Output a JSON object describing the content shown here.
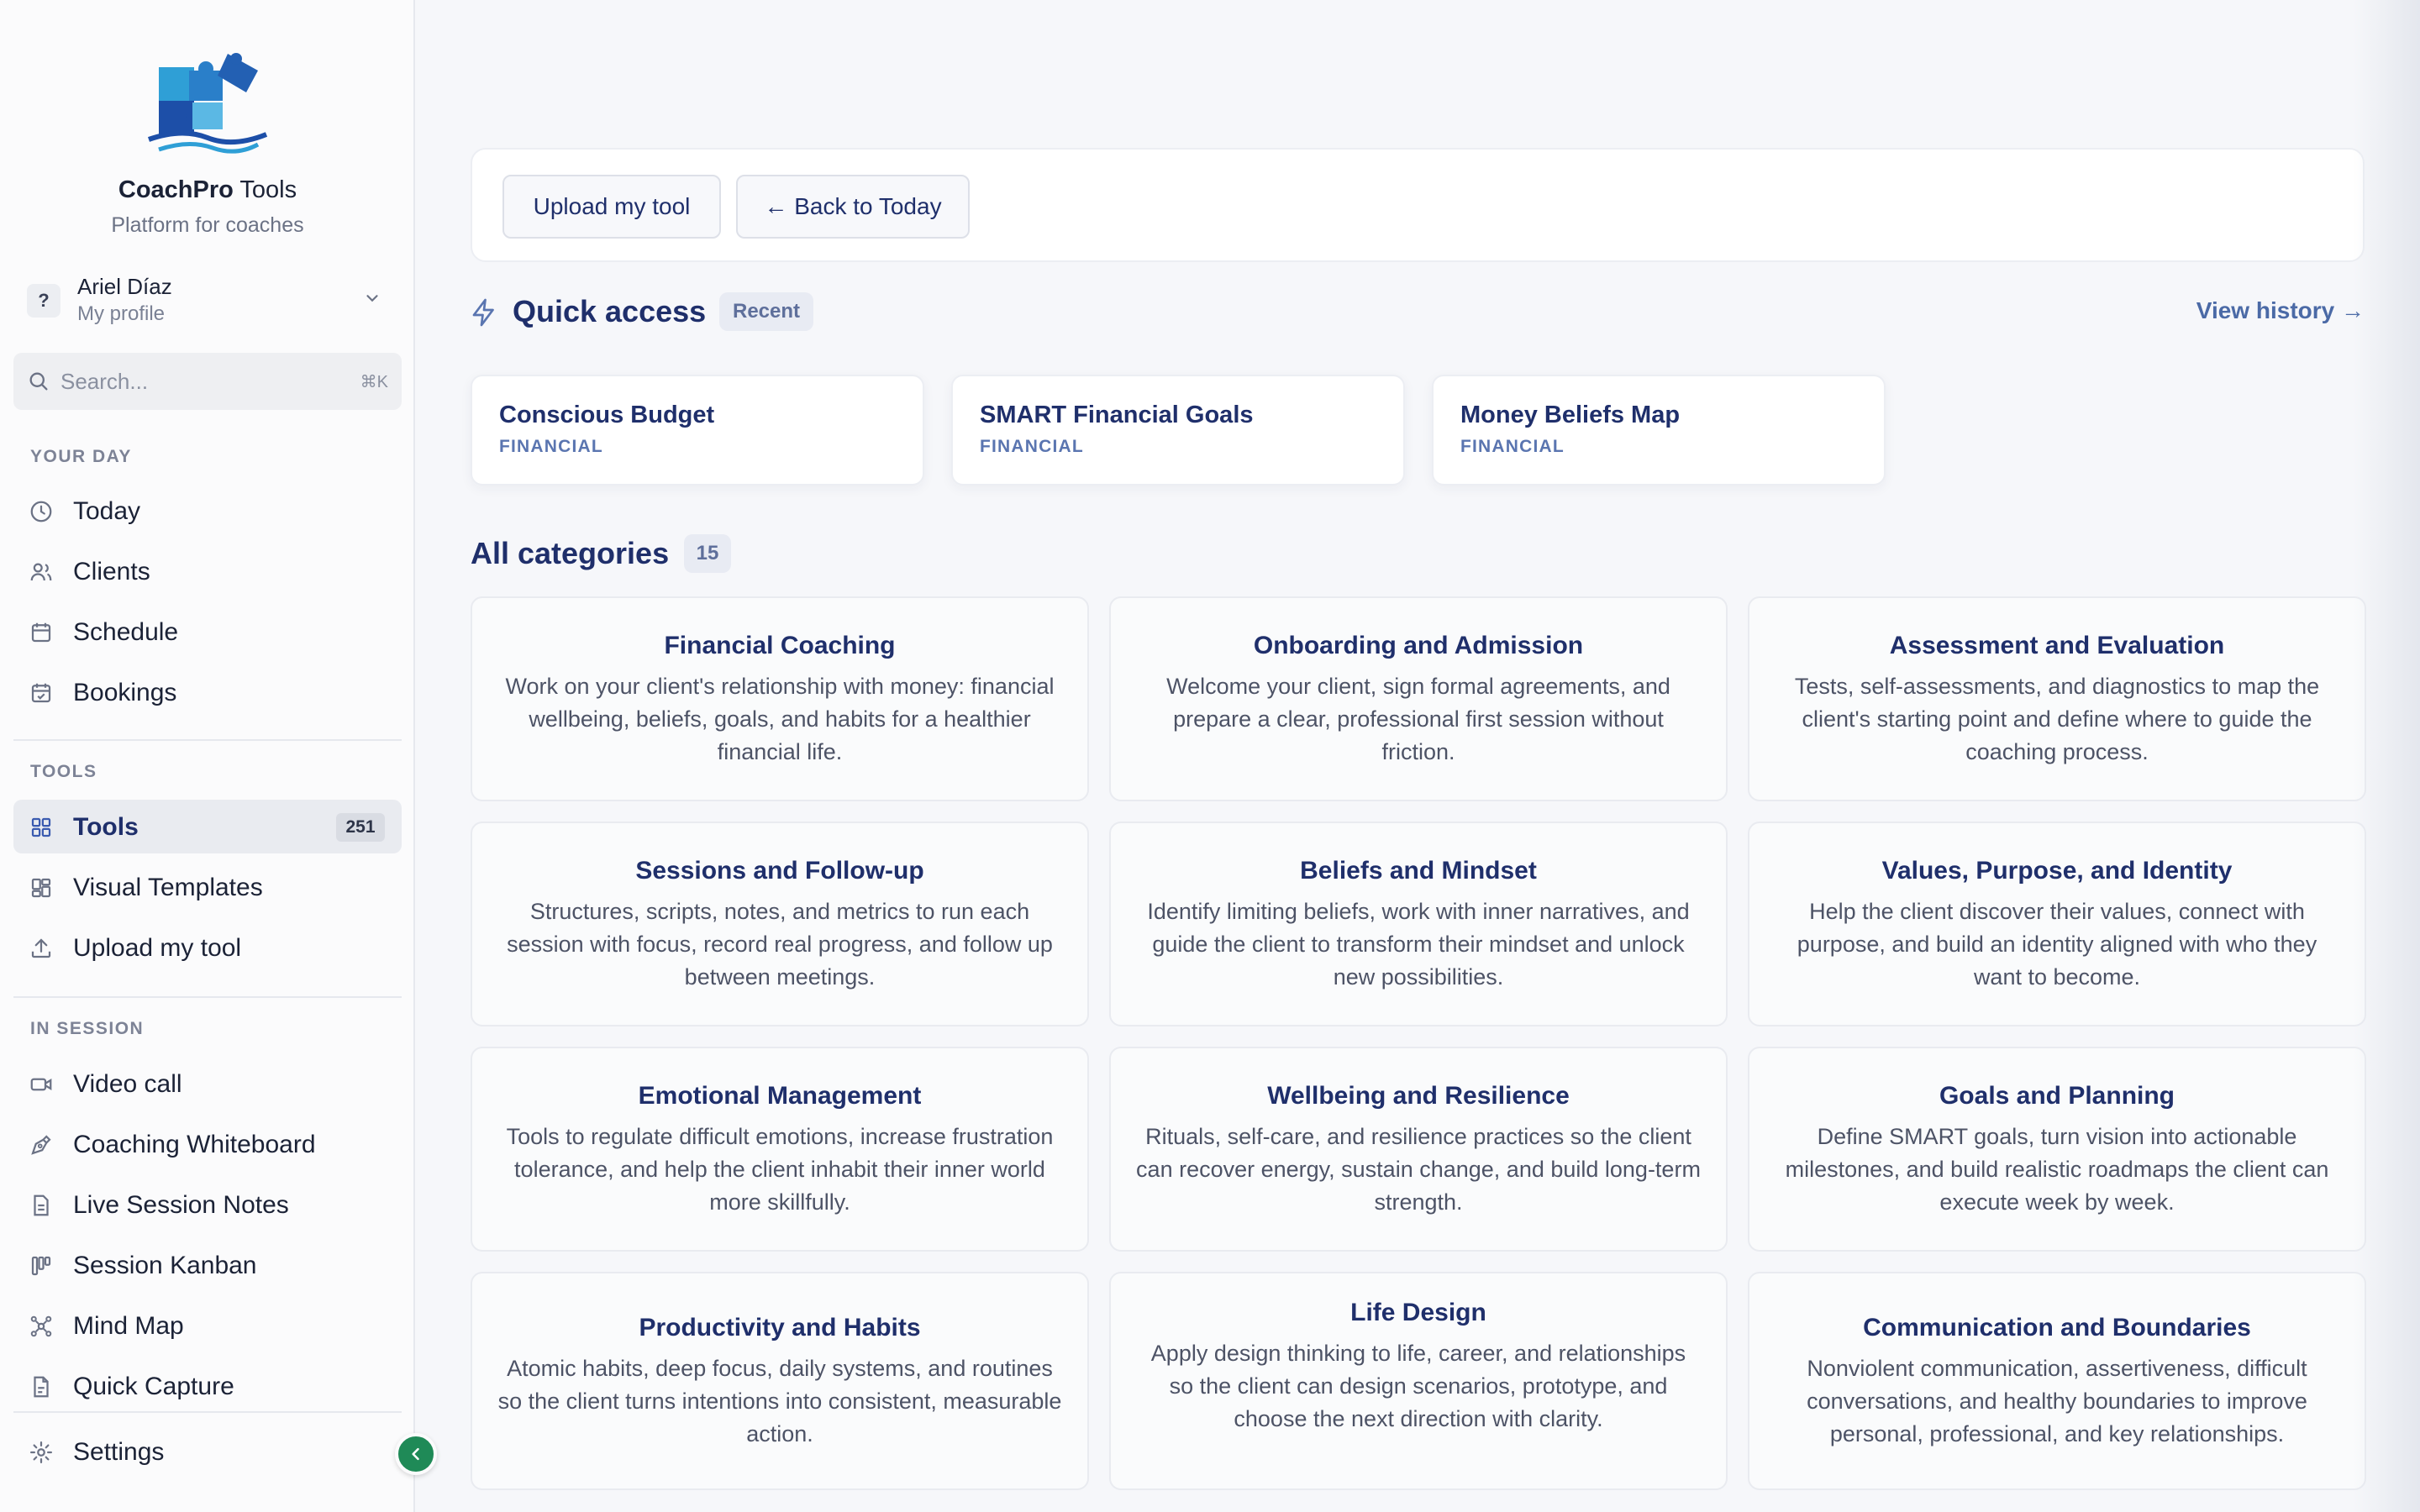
{
  "brand": {
    "name_bold": "CoachPro",
    "name_rest": " Tools",
    "subtitle": "Platform for coaches"
  },
  "profile": {
    "avatar": "?",
    "name": "Ariel Díaz",
    "subtitle": "My profile"
  },
  "search": {
    "placeholder": "Search...",
    "shortcut": "⌘K"
  },
  "sidebar": {
    "sections": [
      {
        "label": "YOUR DAY"
      },
      {
        "label": "TOOLS"
      },
      {
        "label": "IN SESSION"
      }
    ],
    "items": [
      {
        "label": "Today",
        "icon": "clock-icon"
      },
      {
        "label": "Clients",
        "icon": "users-icon"
      },
      {
        "label": "Schedule",
        "icon": "calendar-icon"
      },
      {
        "label": "Bookings",
        "icon": "calendar-check-icon"
      },
      {
        "label": "Tools",
        "icon": "grid-icon",
        "badge": "251",
        "active": true
      },
      {
        "label": "Visual Templates",
        "icon": "layout-icon"
      },
      {
        "label": "Upload my tool",
        "icon": "upload-icon"
      },
      {
        "label": "Video call",
        "icon": "video-icon"
      },
      {
        "label": "Coaching Whiteboard",
        "icon": "pen-tool-icon"
      },
      {
        "label": "Live Session Notes",
        "icon": "file-text-icon"
      },
      {
        "label": "Session Kanban",
        "icon": "kanban-icon"
      },
      {
        "label": "Mind Map",
        "icon": "network-icon"
      },
      {
        "label": "Quick Capture",
        "icon": "file-icon"
      }
    ],
    "settings_label": "Settings"
  },
  "toolbar": {
    "upload_label": "Upload my tool",
    "back_label": "← Back to Today"
  },
  "quick_access": {
    "title": "Quick access",
    "badge": "Recent",
    "view_history": "View history →",
    "cards": [
      {
        "name": "Conscious Budget",
        "category": "FINANCIAL"
      },
      {
        "name": "SMART Financial Goals",
        "category": "FINANCIAL"
      },
      {
        "name": "Money Beliefs Map",
        "category": "FINANCIAL"
      }
    ]
  },
  "categories": {
    "title": "All categories",
    "count": "15",
    "items": [
      {
        "title": "Financial Coaching",
        "desc": "Work on your client's relationship with money: financial wellbeing, beliefs, goals, and habits for a healthier financial life."
      },
      {
        "title": "Onboarding and Admission",
        "desc": "Welcome your client, sign formal agreements, and prepare a clear, professional first session without friction."
      },
      {
        "title": "Assessment and Evaluation",
        "desc": "Tests, self-assessments, and diagnostics to map the client's starting point and define where to guide the coaching process."
      },
      {
        "title": "Sessions and Follow-up",
        "desc": "Structures, scripts, notes, and metrics to run each session with focus, record real progress, and follow up between meetings."
      },
      {
        "title": "Beliefs and Mindset",
        "desc": "Identify limiting beliefs, work with inner narratives, and guide the client to transform their mindset and unlock new possibilities."
      },
      {
        "title": "Values, Purpose, and Identity",
        "desc": "Help the client discover their values, connect with purpose, and build an identity aligned with who they want to become."
      },
      {
        "title": "Emotional Management",
        "desc": "Tools to regulate difficult emotions, increase frustration tolerance, and help the client inhabit their inner world more skillfully."
      },
      {
        "title": "Wellbeing and Resilience",
        "desc": "Rituals, self-care, and resilience practices so the client can recover energy, sustain change, and build long-term strength."
      },
      {
        "title": "Goals and Planning",
        "desc": "Define SMART goals, turn vision into actionable milestones, and build realistic roadmaps the client can execute week by week."
      },
      {
        "title": "Productivity and Habits",
        "desc": "Atomic habits, deep focus, daily systems, and routines so the client turns intentions into consistent, measurable action."
      },
      {
        "title": "Life Design",
        "desc": "Apply design thinking to life, career, and relationships so the client can design scenarios, prototype, and choose the next direction with clarity."
      },
      {
        "title": "Communication and Boundaries",
        "desc": "Nonviolent communication, assertiveness, difficult conversations, and healthy boundaries to improve personal, professional, and key relationships."
      }
    ]
  },
  "colors": {
    "accent": "#1f2f6b",
    "category_label": "#5a75b0",
    "collapse_button": "#1f8a57"
  }
}
